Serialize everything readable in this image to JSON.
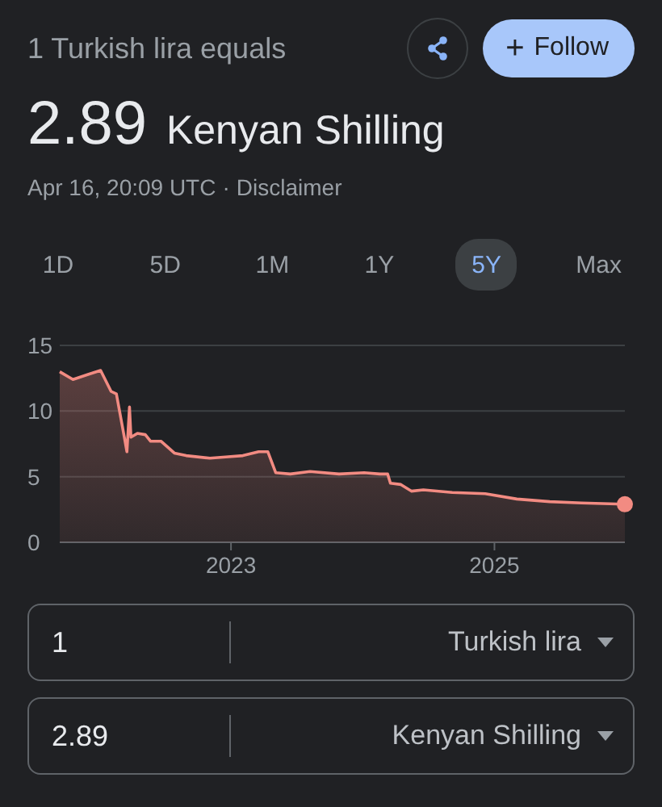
{
  "header": {
    "subtitle": "1 Turkish lira equals",
    "value": "2.89",
    "currency": "Kenyan Shilling",
    "timestamp": "Apr 16, 20:09 UTC",
    "separator": "·",
    "disclaimer": "Disclaimer"
  },
  "actions": {
    "follow": {
      "icon": "+",
      "label": "Follow"
    }
  },
  "ranges": [
    {
      "label": "1D",
      "selected": false
    },
    {
      "label": "5D",
      "selected": false
    },
    {
      "label": "1M",
      "selected": false
    },
    {
      "label": "1Y",
      "selected": false
    },
    {
      "label": "5Y",
      "selected": true
    },
    {
      "label": "Max",
      "selected": false
    }
  ],
  "chart": {
    "chart_data": {
      "type": "area",
      "xlim": [
        2021.7,
        2025.99
      ],
      "ylim": [
        0,
        15
      ],
      "xticks": [
        {
          "value": 2023,
          "label": "2023"
        },
        {
          "value": 2025,
          "label": "2025"
        }
      ],
      "yticks": [
        0,
        5,
        10,
        15
      ],
      "series": [
        {
          "color": "#f28b82",
          "x": [
            2021.7,
            2021.8,
            2021.92,
            2022.01,
            2022.09,
            2022.13,
            2022.19,
            2022.21,
            2022.23,
            2022.24,
            2022.29,
            2022.35,
            2022.39,
            2022.47,
            2022.57,
            2022.66,
            2022.84,
            2022.96,
            2023.09,
            2023.21,
            2023.28,
            2023.34,
            2023.45,
            2023.6,
            2023.82,
            2024.01,
            2024.13,
            2024.19,
            2024.21,
            2024.29,
            2024.37,
            2024.46,
            2024.68,
            2024.93,
            2025.17,
            2025.42,
            2025.66,
            2025.99
          ],
          "values": [
            13.0,
            12.4,
            12.8,
            13.1,
            11.5,
            11.3,
            8.0,
            6.9,
            10.3,
            8.0,
            8.3,
            8.2,
            7.7,
            7.7,
            6.8,
            6.6,
            6.4,
            6.5,
            6.6,
            6.9,
            6.9,
            5.3,
            5.2,
            5.4,
            5.2,
            5.3,
            5.2,
            5.2,
            4.5,
            4.4,
            3.9,
            4.0,
            3.8,
            3.7,
            3.3,
            3.1,
            3.0,
            2.9
          ]
        }
      ]
    }
  },
  "converter": [
    {
      "amount": "1",
      "currency": "Turkish lira"
    },
    {
      "amount": "2.89",
      "currency": "Kenyan Shilling"
    }
  ]
}
